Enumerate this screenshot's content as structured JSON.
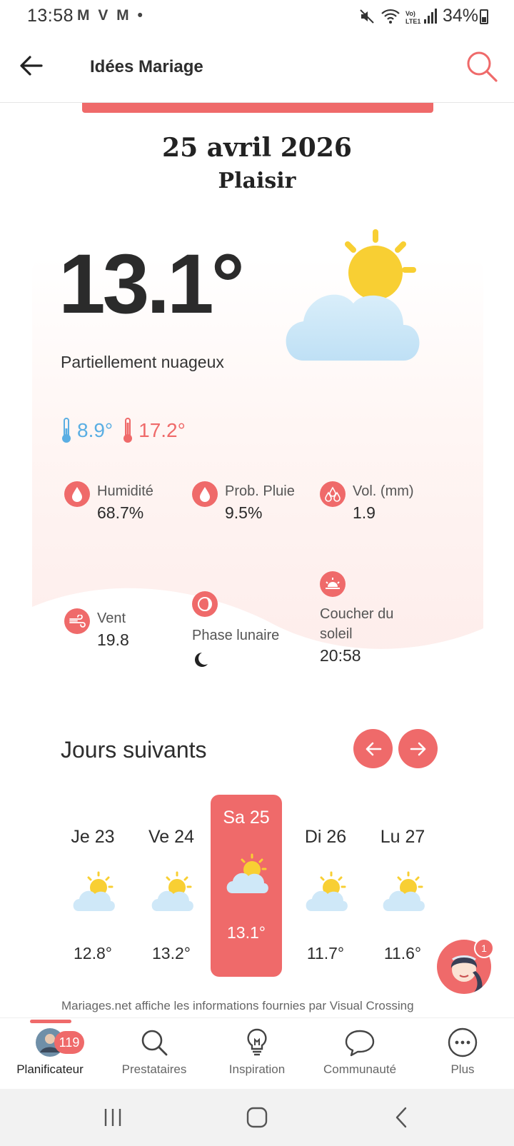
{
  "status_bar": {
    "time": "13:58",
    "notif_icons": "M V M •",
    "battery": "34%"
  },
  "app_bar": {
    "title": "Idées Mariage"
  },
  "header": {
    "date": "25 avril 2026",
    "place": "Plaisir"
  },
  "current": {
    "temperature": "13.1°",
    "condition": "Partiellement nuageux",
    "min": "8.9°",
    "max": "17.2°"
  },
  "stats": {
    "humidity": {
      "label": "Humidité",
      "value": "68.7%"
    },
    "rain_prob": {
      "label": "Prob. Pluie",
      "value": "9.5%"
    },
    "rain_vol": {
      "label": "Vol. (mm)",
      "value": "1.9"
    },
    "wind": {
      "label": "Vent",
      "value": "19.8"
    },
    "moon": {
      "label": "Phase lunaire"
    },
    "sunset": {
      "label": "Coucher du soleil",
      "value": "20:58"
    }
  },
  "forecast": {
    "title": "Jours suivants",
    "days": [
      {
        "name": "Je 23",
        "temp": "12.8°"
      },
      {
        "name": "Ve 24",
        "temp": "13.2°"
      },
      {
        "name": "Sa 25",
        "temp": "13.1°"
      },
      {
        "name": "Di 26",
        "temp": "11.7°"
      },
      {
        "name": "Lu 27",
        "temp": "11.6°"
      }
    ],
    "selected_index": 2
  },
  "chat_fab": {
    "badge": "1"
  },
  "attribution": "Mariages.net affiche les informations fournies par Visual Crossing",
  "bottom_nav": {
    "items": [
      {
        "label": "Planificateur",
        "badge": "119"
      },
      {
        "label": "Prestataires"
      },
      {
        "label": "Inspiration"
      },
      {
        "label": "Communauté"
      },
      {
        "label": "Plus"
      }
    ]
  },
  "colors": {
    "accent": "#ef6a6a",
    "cold": "#5aaee3",
    "sun": "#f8cf33",
    "cloud": "#cfe8f8"
  }
}
